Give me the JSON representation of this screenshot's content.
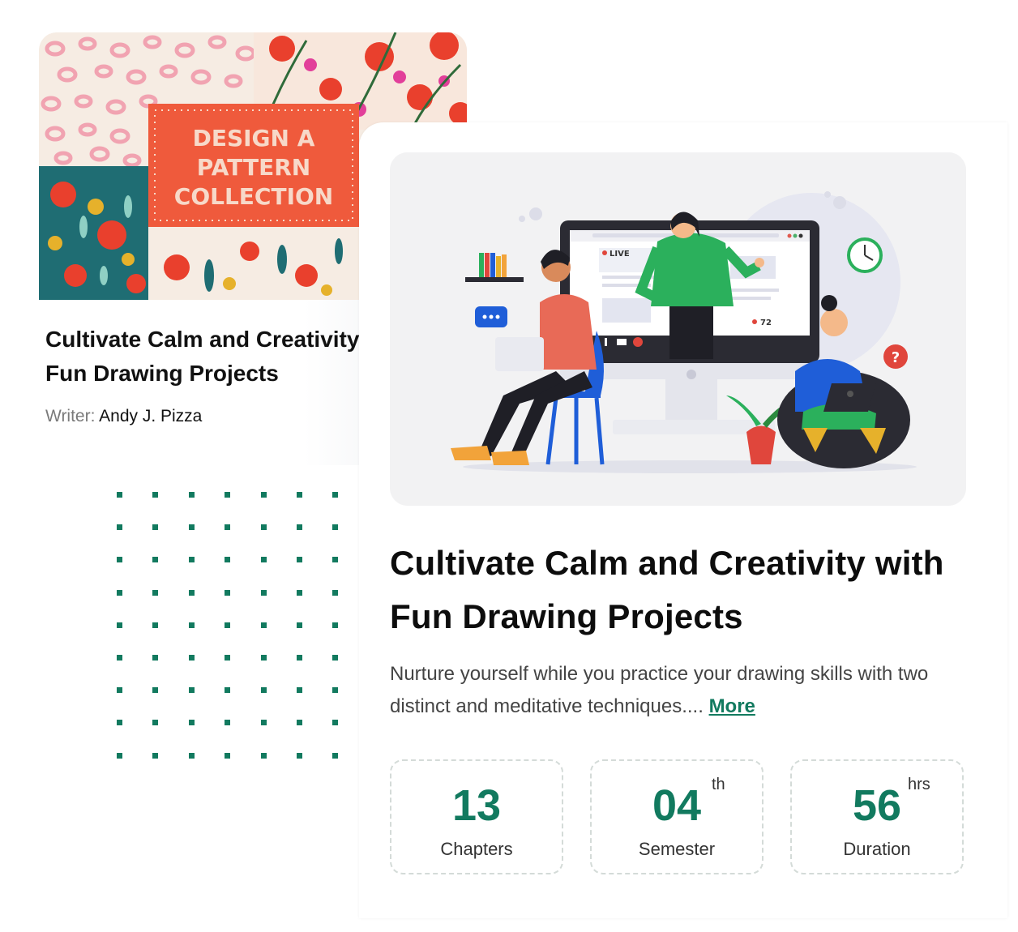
{
  "back_card": {
    "thumb_title_lines": [
      "DESIGN A",
      "PATTERN",
      "COLLECTION"
    ],
    "title_line1": "Cultivate Calm and Creativity",
    "title_line2": "Fun Drawing Projects",
    "writer_label": "Writer:",
    "writer_name": "Andy J. Pizza"
  },
  "illustration": {
    "live_label": "LIVE",
    "viewer_count": "72"
  },
  "main_card": {
    "title_line1": "Cultivate Calm and Creativity with",
    "title_line2": "Fun Drawing Projects",
    "description": "Nurture yourself while you practice your drawing skills with two distinct and meditative techniques....",
    "more_label": "More"
  },
  "stats": [
    {
      "value": "13",
      "suffix": "",
      "label": "Chapters"
    },
    {
      "value": "04",
      "suffix": "th",
      "label": "Semester"
    },
    {
      "value": "56",
      "suffix": "hrs",
      "label": "Duration"
    }
  ],
  "colors": {
    "accent": "#127a5f",
    "banner": "#ef5a3c",
    "banner_text": "#f7d9c9"
  }
}
